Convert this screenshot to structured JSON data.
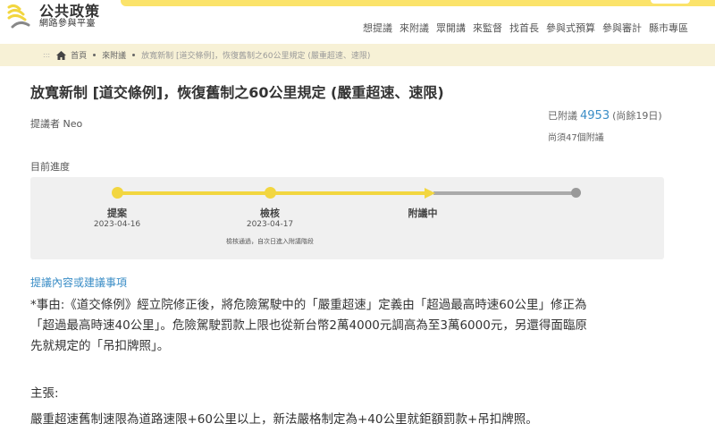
{
  "header": {
    "logo_title": "公共政策",
    "logo_subtitle": "網路參與平臺",
    "nav": [
      "想提議",
      "來附議",
      "眾開講",
      "來監督",
      "找首長",
      "參與式預算",
      "參與審計",
      "縣市專區"
    ]
  },
  "breadcrumb": {
    "home": "首頁",
    "section": "來附議",
    "current": "放寬新制 [道交條例]，恢復舊制之60公里規定 (嚴重超速、速限)"
  },
  "proposal": {
    "title": "放寬新制 [道交條例]，恢復舊制之60公里規定 (嚴重超速、速限)",
    "proposer_label": "提議者",
    "proposer_name": "Neo",
    "signed_label": "已附議",
    "signed_count": "4953",
    "remaining": "(尚餘19日)",
    "needed": "尚須47個附議"
  },
  "progress": {
    "label": "目前進度",
    "stages": [
      {
        "name": "提案",
        "date": "2023-04-16"
      },
      {
        "name": "檢核",
        "date": "2023-04-17",
        "note": "檢核通過，自次日進入附議階段"
      },
      {
        "name": "附議中"
      }
    ]
  },
  "content": {
    "heading": "提議內容或建議事項",
    "line1": "*事由:《道交條例》經立院修正後，將危險駕駛中的「嚴重超速」定義由「超過最高時速60公里」修正為",
    "line2": "「超過最高時速40公里」。危險駕駛罰款上限也從新台幣2萬4000元調高為至3萬6000元，另還得面臨原",
    "line3": "先就規定的「吊扣牌照」。",
    "claim_label": "主張:",
    "claim_text": "嚴重超速舊制速限為道路速限+60公里以上，新法嚴格制定為+40公里就鉅額罰款+吊扣牌照。"
  },
  "colors": {
    "accent_yellow": "#f2d640",
    "link_blue": "#3a8dc6",
    "breadcrumb_bg": "#f7f1d6"
  }
}
